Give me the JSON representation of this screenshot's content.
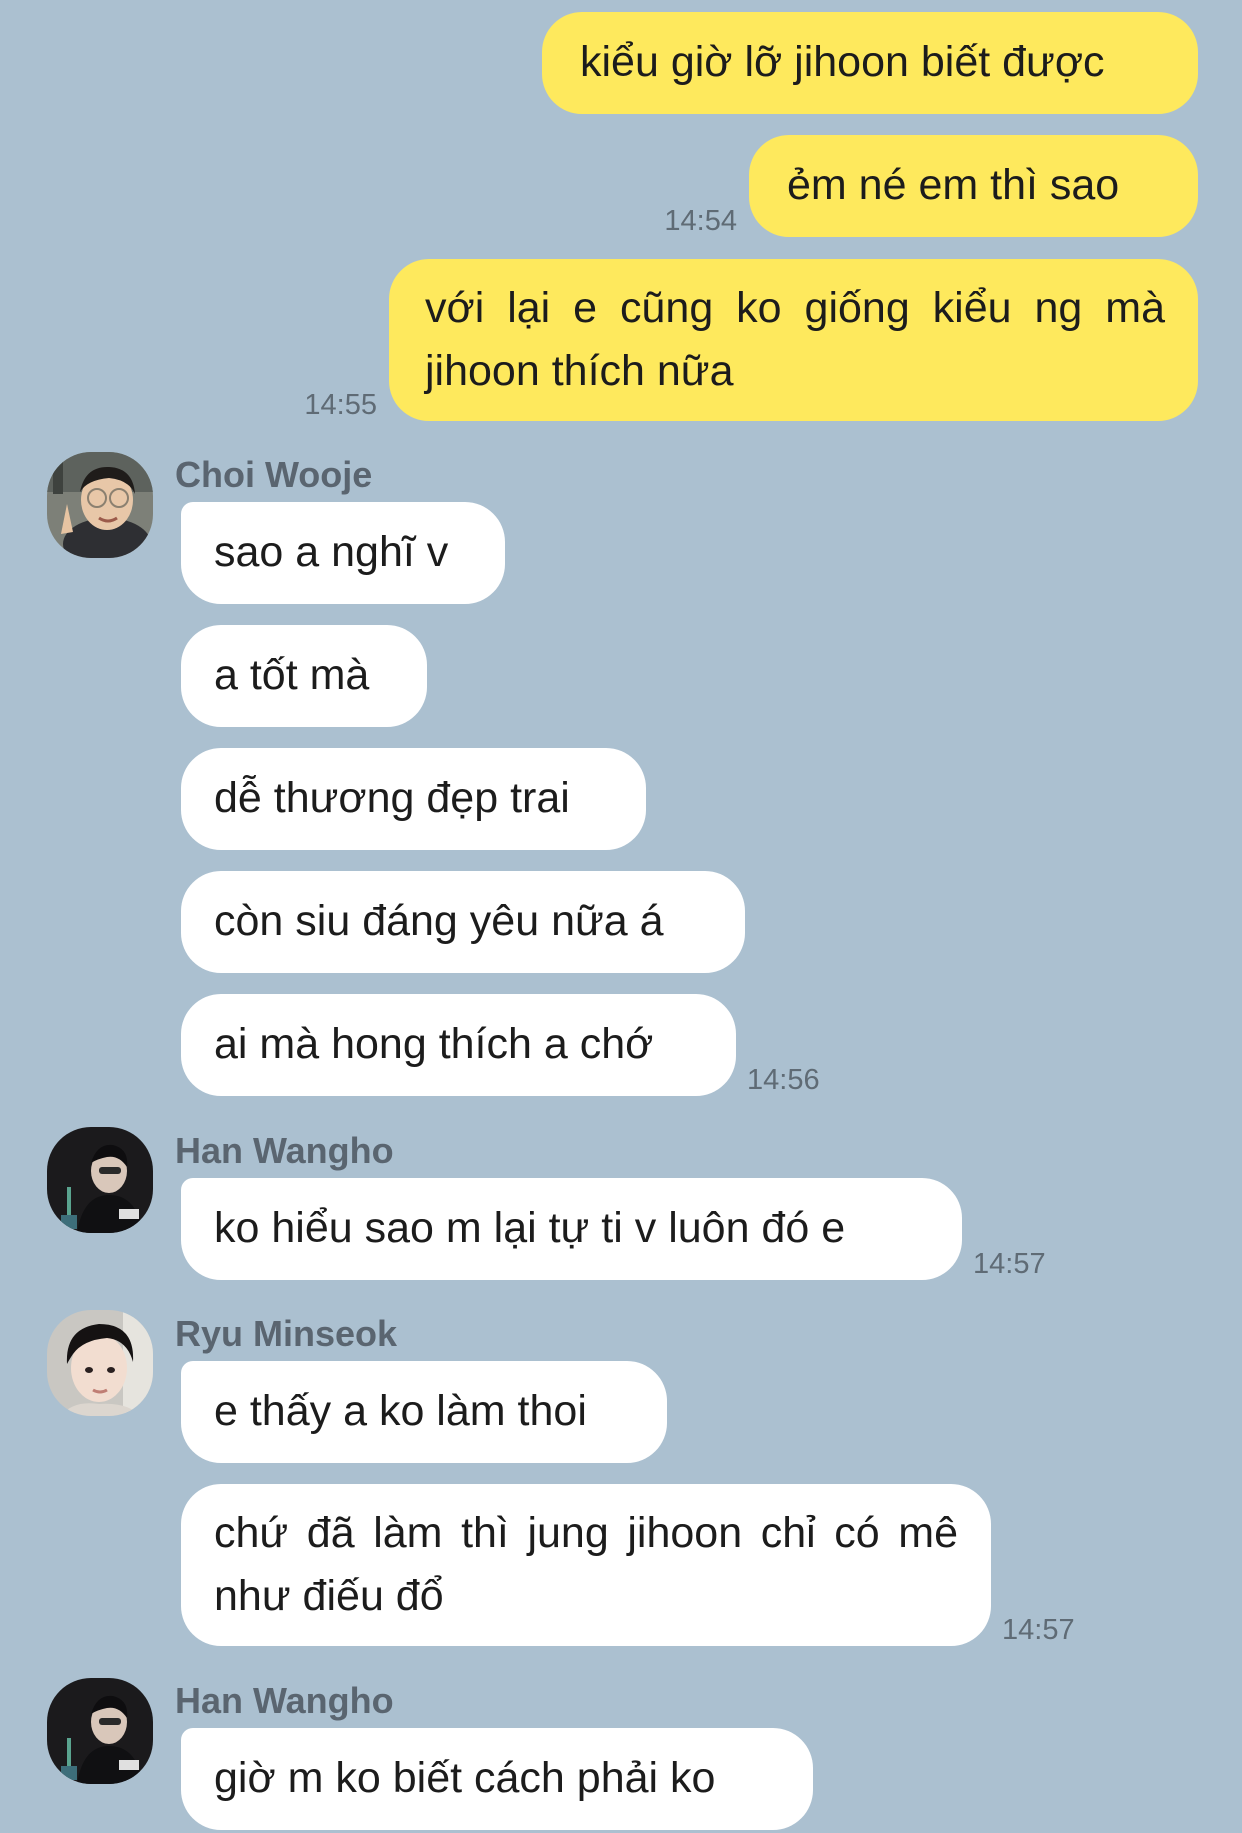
{
  "messages_out": [
    {
      "text": "kiểu giờ lỡ jihoon biết được",
      "time": ""
    },
    {
      "text": "ẻm né em thì sao",
      "time": "14:54"
    },
    {
      "text": "với lại e cũng ko giống kiểu ng mà jihoon thích nữa",
      "time": "14:55"
    }
  ],
  "groups": [
    {
      "sender": "Choi Wooje",
      "avatar_icon": "user-photo-icon",
      "messages": [
        {
          "text": "sao a nghĩ v",
          "time": ""
        },
        {
          "text": "a tốt mà",
          "time": ""
        },
        {
          "text": "dễ thương đẹp trai",
          "time": ""
        },
        {
          "text": "còn siu đáng yêu nữa á",
          "time": ""
        },
        {
          "text": "ai mà hong thích a chớ",
          "time": "14:56"
        }
      ]
    },
    {
      "sender": "Han Wangho",
      "avatar_icon": "user-photo-icon",
      "messages": [
        {
          "text": "ko hiểu sao m lại tự ti v luôn đó e",
          "time": "14:57"
        }
      ]
    },
    {
      "sender": "Ryu Minseok",
      "avatar_icon": "user-photo-icon",
      "messages": [
        {
          "text": "e thấy a ko làm thoi",
          "time": ""
        },
        {
          "text": "chứ đã làm thì jung jihoon chỉ có mê như điếu đổ",
          "time": "14:57"
        }
      ]
    },
    {
      "sender": "Han Wangho",
      "avatar_icon": "user-photo-icon",
      "messages": [
        {
          "text": "giờ m ko biết cách phải ko",
          "time": ""
        }
      ]
    }
  ],
  "colors": {
    "background": "#abc0d0",
    "outgoing_bubble": "#fee95d",
    "incoming_bubble": "#ffffff"
  }
}
